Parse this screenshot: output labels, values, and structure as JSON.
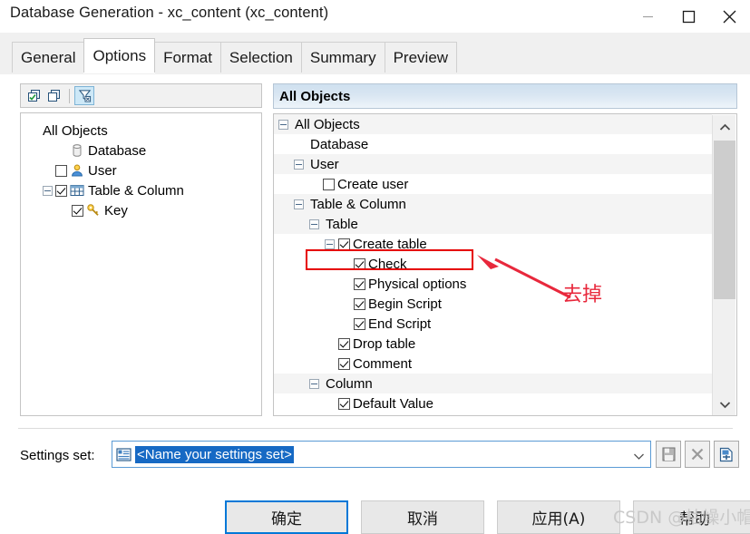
{
  "window": {
    "title": "Database Generation - xc_content (xc_content)",
    "controls": [
      {
        "name": "minimize-button",
        "glyph": "minimize-icon"
      },
      {
        "name": "maximize-button",
        "glyph": "maximize-icon"
      },
      {
        "name": "close-button",
        "glyph": "close-icon"
      }
    ]
  },
  "tabs": [
    {
      "label": "General",
      "active": false
    },
    {
      "label": "Options",
      "active": true
    },
    {
      "label": "Format",
      "active": false
    },
    {
      "label": "Selection",
      "active": false
    },
    {
      "label": "Summary",
      "active": false
    },
    {
      "label": "Preview",
      "active": false
    }
  ],
  "left_pane": {
    "toolbar": [
      {
        "name": "select-all-icon",
        "selected": false
      },
      {
        "name": "deselect-all-icon",
        "selected": false
      },
      {
        "name": "filter-icon",
        "selected": true
      }
    ],
    "tree": [
      {
        "label": "All Objects",
        "indent": 0,
        "checkbox": "none",
        "icon": "none",
        "expander": "none"
      },
      {
        "label": "Database",
        "indent": 1,
        "checkbox": "none",
        "icon": "database-icon",
        "expander": "none"
      },
      {
        "label": "User",
        "indent": 1,
        "checkbox": "unchecked",
        "icon": "user-icon",
        "expander": "none"
      },
      {
        "label": "Table & Column",
        "indent": 1,
        "checkbox": "checked",
        "icon": "table-icon",
        "expander": "minus"
      },
      {
        "label": "Key",
        "indent": 2,
        "checkbox": "checked",
        "icon": "key-icon",
        "expander": "none"
      }
    ]
  },
  "right_pane": {
    "header": "All Objects",
    "tree": [
      {
        "label": "All Objects",
        "indent": 0,
        "expander": "minus",
        "checkbox": "none",
        "shaded": true
      },
      {
        "label": "Database",
        "indent": 1,
        "expander": "none",
        "checkbox": "none",
        "shaded": false
      },
      {
        "label": "User",
        "indent": 1,
        "expander": "minus",
        "checkbox": "none",
        "shaded": true
      },
      {
        "label": "Create user",
        "indent": 2,
        "expander": "none",
        "checkbox": "unchecked",
        "shaded": false,
        "highlighted": true
      },
      {
        "label": "Table & Column",
        "indent": 1,
        "expander": "minus",
        "checkbox": "none",
        "shaded": true
      },
      {
        "label": "Table",
        "indent": 2,
        "expander": "minus",
        "checkbox": "none",
        "shaded": true
      },
      {
        "label": "Create table",
        "indent": 3,
        "expander": "minus",
        "checkbox": "checked",
        "shaded": false
      },
      {
        "label": "Check",
        "indent": 4,
        "expander": "none",
        "checkbox": "checked",
        "shaded": false
      },
      {
        "label": "Physical options",
        "indent": 4,
        "expander": "none",
        "checkbox": "checked",
        "shaded": false
      },
      {
        "label": "Begin Script",
        "indent": 4,
        "expander": "none",
        "checkbox": "checked",
        "shaded": false
      },
      {
        "label": "End Script",
        "indent": 4,
        "expander": "none",
        "checkbox": "checked",
        "shaded": false
      },
      {
        "label": "Drop table",
        "indent": 3,
        "expander": "none",
        "checkbox": "checked",
        "shaded": false
      },
      {
        "label": "Comment",
        "indent": 3,
        "expander": "none",
        "checkbox": "checked",
        "shaded": false
      },
      {
        "label": "Column",
        "indent": 2,
        "expander": "minus",
        "checkbox": "none",
        "shaded": true
      },
      {
        "label": "Default Value",
        "indent": 3,
        "expander": "none",
        "checkbox": "checked",
        "shaded": false
      }
    ],
    "scrollbar": {
      "up_arrow": "chevron-up-icon",
      "down_arrow": "chevron-down-icon"
    }
  },
  "annotation": {
    "text": "去掉",
    "color": "#e8283c"
  },
  "settings": {
    "label": "Settings set:",
    "value": "<Name your settings set>",
    "icon": "settings-set-icon",
    "dropdown_icon": "chevron-down-icon",
    "buttons": [
      {
        "name": "save-settings-set-button",
        "icon": "save-icon"
      },
      {
        "name": "delete-settings-set-button",
        "icon": "close-x-icon"
      },
      {
        "name": "import-settings-set-button",
        "icon": "import-icon"
      }
    ]
  },
  "footer": {
    "ok": "确定",
    "cancel": "取消",
    "apply": "应用(A)",
    "help": "帮助"
  },
  "watermark": "CSDN @枯燥小帽",
  "colors": {
    "accent": "#0078d7",
    "selection": "#1669c4",
    "annotation": "#e60000",
    "header_gradient_start": "#cfe0ef"
  }
}
